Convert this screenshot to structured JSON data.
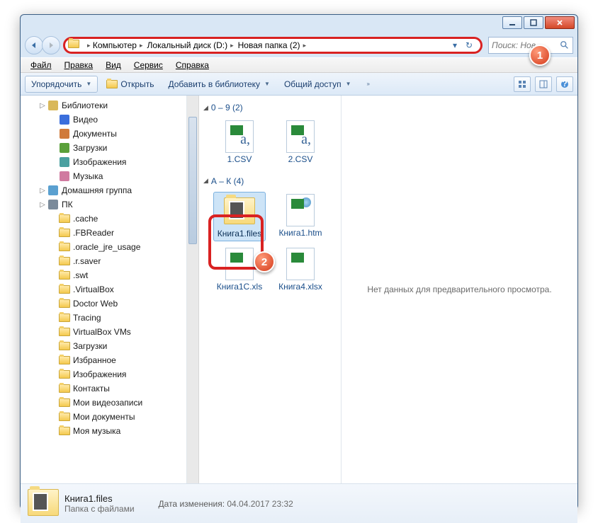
{
  "window": {
    "controls": {
      "min": "minimize",
      "max": "maximize",
      "close": "close"
    }
  },
  "breadcrumb": [
    "Компьютер",
    "Локальный диск (D:)",
    "Новая папка (2)"
  ],
  "search": {
    "placeholder": "Поиск: Нов..."
  },
  "menubar": [
    {
      "label": "Файл",
      "u": "Ф"
    },
    {
      "label": "Правка",
      "u": "П"
    },
    {
      "label": "Вид",
      "u": "В"
    },
    {
      "label": "Сервис",
      "u": "С"
    },
    {
      "label": "Справка",
      "u": "С"
    }
  ],
  "toolbar": {
    "organize": "Упорядочить",
    "open": "Открыть",
    "add_to_library": "Добавить в библиотеку",
    "share": "Общий доступ"
  },
  "sidebar": [
    {
      "label": "Библиотеки",
      "lvl": 0,
      "icon": "libraries"
    },
    {
      "label": "Видео",
      "lvl": 1,
      "icon": "video"
    },
    {
      "label": "Документы",
      "lvl": 1,
      "icon": "doc"
    },
    {
      "label": "Загрузки",
      "lvl": 1,
      "icon": "download"
    },
    {
      "label": "Изображения",
      "lvl": 1,
      "icon": "image"
    },
    {
      "label": "Музыка",
      "lvl": 1,
      "icon": "music"
    },
    {
      "label": "Домашняя группа",
      "lvl": 0,
      "icon": "homegroup"
    },
    {
      "label": "ПК",
      "lvl": 0,
      "icon": "computer"
    },
    {
      "label": ".cache",
      "lvl": 1,
      "icon": "folder"
    },
    {
      "label": ".FBReader",
      "lvl": 1,
      "icon": "folder"
    },
    {
      "label": ".oracle_jre_usage",
      "lvl": 1,
      "icon": "folder"
    },
    {
      "label": ".r.saver",
      "lvl": 1,
      "icon": "folder"
    },
    {
      "label": ".swt",
      "lvl": 1,
      "icon": "folder"
    },
    {
      "label": ".VirtualBox",
      "lvl": 1,
      "icon": "folder"
    },
    {
      "label": "Doctor Web",
      "lvl": 1,
      "icon": "folder"
    },
    {
      "label": "Tracing",
      "lvl": 1,
      "icon": "folder"
    },
    {
      "label": "VirtualBox VMs",
      "lvl": 1,
      "icon": "folder"
    },
    {
      "label": "Загрузки",
      "lvl": 1,
      "icon": "folder"
    },
    {
      "label": "Избранное",
      "lvl": 1,
      "icon": "folder"
    },
    {
      "label": "Изображения",
      "lvl": 1,
      "icon": "folder"
    },
    {
      "label": "Контакты",
      "lvl": 1,
      "icon": "folder"
    },
    {
      "label": "Мои видеозаписи",
      "lvl": 1,
      "icon": "folder"
    },
    {
      "label": "Мои документы",
      "lvl": 1,
      "icon": "folder"
    },
    {
      "label": "Моя музыка",
      "lvl": 1,
      "icon": "folder"
    }
  ],
  "groups": [
    {
      "header": "0 – 9 (2)",
      "items": [
        {
          "name": "1.CSV",
          "type": "csv"
        },
        {
          "name": "2.CSV",
          "type": "csv"
        }
      ]
    },
    {
      "header": "А – К (4)",
      "items": [
        {
          "name": "Книга1.files",
          "type": "folder",
          "selected": true
        },
        {
          "name": "Книга1.htm",
          "type": "htm"
        },
        {
          "name": "Книга1С.xls",
          "type": "xls"
        },
        {
          "name": "Книга4.xlsx",
          "type": "xlsx"
        }
      ]
    }
  ],
  "preview": {
    "empty_text": "Нет данных для предварительного просмотра."
  },
  "details": {
    "name": "Книга1.files",
    "type": "Папка с файлами",
    "modified_label": "Дата изменения:",
    "modified_value": "04.04.2017 23:32"
  },
  "callouts": {
    "c1": "1",
    "c2": "2"
  }
}
